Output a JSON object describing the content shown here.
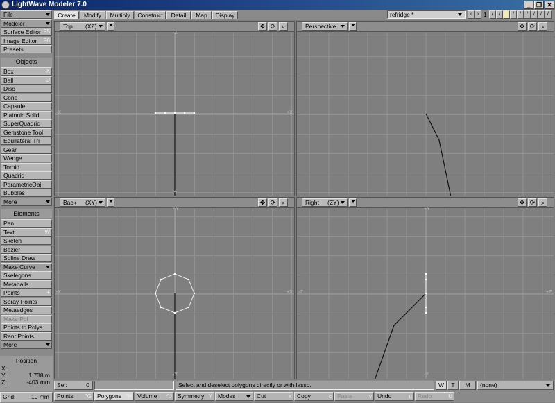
{
  "window": {
    "title": "LightWave Modeler 7.0",
    "buttons": [
      "_",
      "❐",
      "✕"
    ]
  },
  "left_panel": {
    "top_buttons": [
      {
        "label": "File",
        "dropdown": true
      },
      {
        "label": "Modeler",
        "dropdown": true
      },
      {
        "label": "Surface Editor",
        "shortcut": "F5"
      },
      {
        "label": "Image Editor",
        "shortcut": "F6"
      },
      {
        "label": "Presets"
      }
    ],
    "objects_header": "Objects",
    "objects": [
      {
        "label": "Box",
        "shortcut": "X"
      },
      {
        "label": "Ball",
        "shortcut": "O"
      },
      {
        "label": "Disc"
      },
      {
        "label": "Cone"
      },
      {
        "label": "Capsule"
      },
      {
        "label": "Platonic Solid"
      },
      {
        "label": "SuperQuadric"
      },
      {
        "label": "Gemstone Tool"
      },
      {
        "label": "Equilateral Tri"
      },
      {
        "label": "Gear"
      },
      {
        "label": "Wedge"
      },
      {
        "label": "Toroid"
      },
      {
        "label": "Quadric"
      },
      {
        "label": "ParametricObj"
      },
      {
        "label": "Bubbles"
      },
      {
        "label": "More",
        "dropdown": true
      }
    ],
    "elements_header": "Elements",
    "elements": [
      {
        "label": "Pen"
      },
      {
        "label": "Text",
        "shortcut": "W"
      },
      {
        "label": "Sketch"
      },
      {
        "label": "Bezier"
      },
      {
        "label": "Spline Draw"
      },
      {
        "label": "Make Curve",
        "dropdown": true
      },
      {
        "label": "Skelegons"
      },
      {
        "label": "Metaballs"
      },
      {
        "label": "Points",
        "shortcut": "+"
      },
      {
        "label": "Spray Points"
      },
      {
        "label": "Metaedges"
      },
      {
        "label": "Make Pol",
        "disabled": true
      },
      {
        "label": "Points to Polys"
      },
      {
        "label": "RandPoints"
      },
      {
        "label": "More",
        "dropdown": true
      }
    ],
    "position": {
      "title": "Position",
      "x_label": "X:",
      "x_value": "",
      "y_label": "Y:",
      "y_value": "1.738 m",
      "z_label": "Z:",
      "z_value": "-403 mm"
    },
    "grid": {
      "label": "Grid:",
      "value": "10 mm"
    }
  },
  "tabs": {
    "items": [
      "Create",
      "Modify",
      "Multiply",
      "Construct",
      "Detail",
      "Map",
      "Display"
    ],
    "active": "Create",
    "object_selector": "refridge *",
    "layer_number": "1"
  },
  "viewports": [
    {
      "id": "top",
      "title": "Top",
      "axes": "(XZ)",
      "labels": {
        "top": "-Z",
        "bottom": "Z",
        "left": "-X",
        "right": "+X"
      }
    },
    {
      "id": "perspective",
      "title": "Perspective",
      "axes": "",
      "labels": {}
    },
    {
      "id": "back",
      "title": "Back",
      "axes": "(XY)",
      "labels": {
        "top": "+Y",
        "bottom": "-Y",
        "left": "-X",
        "right": "+X"
      }
    },
    {
      "id": "right",
      "title": "Right",
      "axes": "(ZY)",
      "labels": {
        "top": "+Y",
        "bottom": "-Y",
        "left": "-Z",
        "right": "+Z"
      }
    }
  ],
  "status": {
    "sel_label": "Sel:",
    "sel_value": "0",
    "message": "Select and deselect polygons directly or with lasso.",
    "wtm": [
      "W",
      "T",
      "M"
    ],
    "surface": "(none)"
  },
  "bottom_toolbar": [
    {
      "label": "Points",
      "shortcut": "^G"
    },
    {
      "label": "Polygons",
      "shortcut": "^H",
      "active": true
    },
    {
      "label": "Volume",
      "shortcut": "^J"
    },
    {
      "label": "Symmetry",
      "shortcut": "Y"
    },
    {
      "label": "Modes",
      "dropdown": true
    },
    {
      "label": "Cut",
      "shortcut": "x"
    },
    {
      "label": "Copy",
      "shortcut": "c"
    },
    {
      "label": "Paste",
      "shortcut": "v",
      "disabled": true
    },
    {
      "label": "Undo",
      "shortcut": "u"
    },
    {
      "label": "Redo",
      "shortcut": "U",
      "disabled": true
    }
  ]
}
